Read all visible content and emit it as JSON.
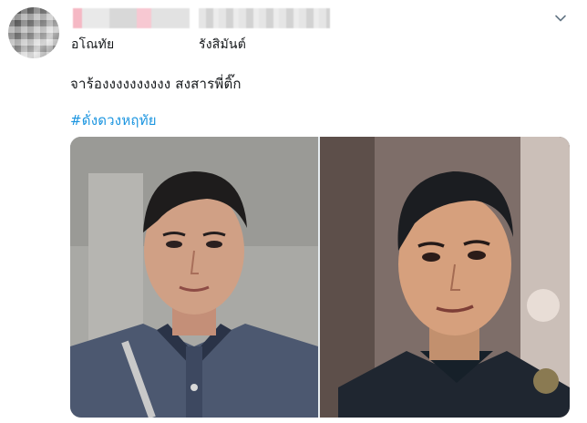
{
  "author": {
    "display_name_line": "อโณทัย",
    "handle_line": "รังสิมันต์"
  },
  "tweet": {
    "text": "จาร้องงงงงงงงงง สงสารพี่ติ๊ก",
    "hashtag": "#ดั่งดวงหฤทัย"
  },
  "icons": {
    "avatar": "avatar",
    "menu": "chevron-down-icon"
  },
  "colors": {
    "link": "#1b95e0",
    "text": "#14171a"
  },
  "media": {
    "count": 2
  }
}
